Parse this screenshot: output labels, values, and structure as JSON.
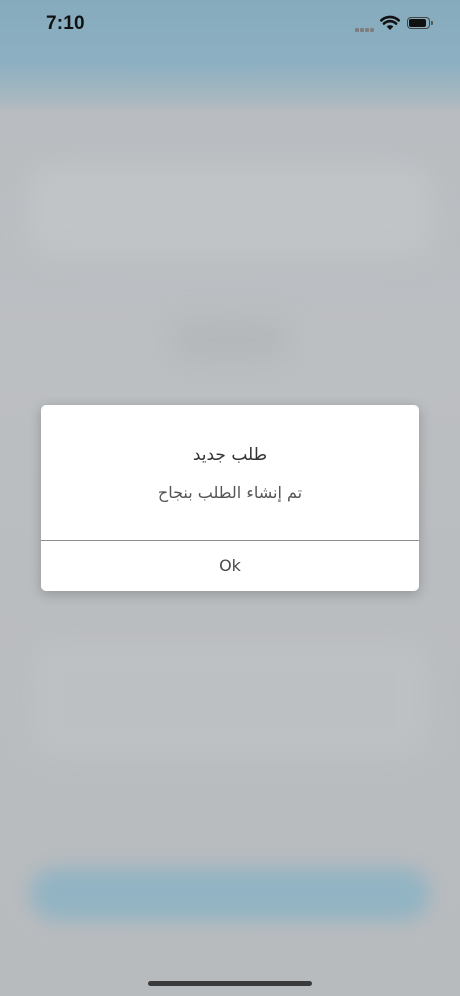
{
  "status_bar": {
    "time": "7:10",
    "signal_icon": "cellular-signal-icon",
    "wifi_icon": "wifi-icon",
    "battery_icon": "battery-icon",
    "battery_level": 0.9
  },
  "dialog": {
    "title": "طلب جديد",
    "message": "تم إنشاء الطلب بنجاح",
    "ok_label": "Ok"
  },
  "colors": {
    "header_tint": "#8cb0c1",
    "overlay": "#b9bcbf",
    "dialog_background": "#ffffff",
    "bottom_button_tint": "#8db3c4"
  }
}
